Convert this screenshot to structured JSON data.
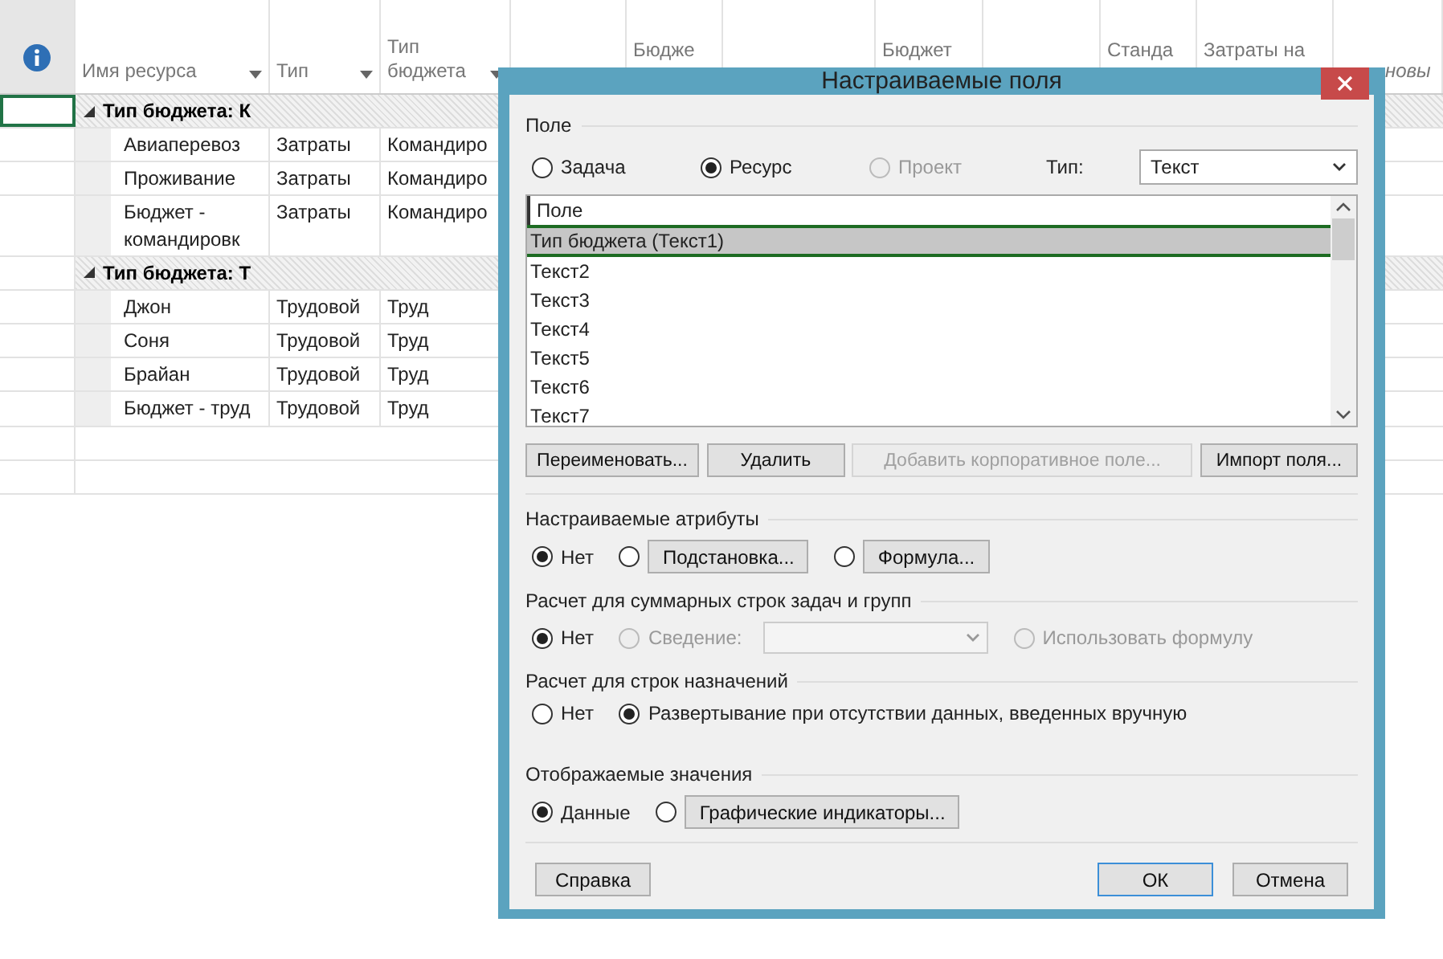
{
  "sheet": {
    "columns": [
      {
        "label": "Имя ресурса",
        "filter": true
      },
      {
        "label": "Тип",
        "filter": true
      },
      {
        "label": "Тип бюджета",
        "filter": true
      },
      {
        "label": "Бюдже",
        "filter": false
      },
      {
        "label": "Бюджет",
        "filter": false
      },
      {
        "label": "Станда",
        "filter": false
      },
      {
        "label": "Затраты на",
        "filter": false
      },
      {
        "label": "новы",
        "filter": false,
        "kind": "add"
      }
    ],
    "groups": [
      {
        "label": "Тип бюджета: К",
        "expanded": true,
        "selected": true,
        "children": [
          {
            "name": "Авиаперевоз",
            "type": "Затраты",
            "budget_type": "Командиро",
            "selected": false
          },
          {
            "name": "Проживание",
            "type": "Затраты",
            "budget_type": "Командиро",
            "selected": false
          },
          {
            "name": "Бюджет - командировк",
            "type": "Затраты",
            "budget_type": "Командиро",
            "selected": false
          }
        ]
      },
      {
        "label": "Тип бюджета: Т",
        "expanded": true,
        "selected": false,
        "children": [
          {
            "name": "Джон",
            "type": "Трудовой",
            "budget_type": "Труд",
            "selected": false
          },
          {
            "name": "Соня",
            "type": "Трудовой",
            "budget_type": "Труд",
            "selected": false
          },
          {
            "name": "Брайан",
            "type": "Трудовой",
            "budget_type": "Труд",
            "selected": false
          },
          {
            "name": "Бюджет - труд",
            "type": "Трудовой",
            "budget_type": "Труд",
            "selected": false
          }
        ]
      }
    ]
  },
  "dialog": {
    "title": "Настраиваемые поля",
    "field": {
      "title": "Поле",
      "scope": [
        {
          "label": "Задача",
          "selected": false,
          "disabled": false
        },
        {
          "label": "Ресурс",
          "selected": true,
          "disabled": false
        },
        {
          "label": "Проект",
          "selected": false,
          "disabled": true
        }
      ],
      "type_label": "Тип:",
      "type_value": "Текст",
      "list_header": "Поле",
      "items": [
        {
          "label": "Тип бюджета (Текст1)",
          "selected": true
        },
        {
          "label": "Текст2",
          "selected": false
        },
        {
          "label": "Текст3",
          "selected": false
        },
        {
          "label": "Текст4",
          "selected": false
        },
        {
          "label": "Текст5",
          "selected": false
        },
        {
          "label": "Текст6",
          "selected": false
        },
        {
          "label": "Текст7",
          "selected": false
        }
      ],
      "buttons": [
        {
          "label": "Переименовать...",
          "disabled": false
        },
        {
          "label": "Удалить",
          "disabled": false
        },
        {
          "label": "Добавить корпоративное поле...",
          "disabled": true
        },
        {
          "label": "Импорт поля...",
          "disabled": false
        }
      ]
    },
    "sections": [
      {
        "title": "Настраиваемые атрибуты",
        "options": [
          {
            "kind": "radio",
            "label": "Нет",
            "selected": true,
            "disabled": false
          },
          {
            "kind": "radio_button",
            "label": "Подстановка...",
            "selected": false,
            "disabled": false
          },
          {
            "kind": "radio_button",
            "label": "Формула...",
            "selected": false,
            "disabled": false
          }
        ]
      },
      {
        "title": "Расчет для суммарных строк задач и групп",
        "options": [
          {
            "kind": "radio",
            "label": "Нет",
            "selected": true,
            "disabled": false
          },
          {
            "kind": "radio_select",
            "label": "Сведение:",
            "selected": false,
            "disabled": true
          },
          {
            "kind": "radio",
            "label": "Использовать формулу",
            "selected": false,
            "disabled": true
          }
        ]
      },
      {
        "title": "Расчет для строк назначений",
        "options": [
          {
            "kind": "radio",
            "label": "Нет",
            "selected": false,
            "disabled": false
          },
          {
            "kind": "radio",
            "label": "Развертывание при отсутствии данных, введенных вручную",
            "selected": true,
            "disabled": false
          }
        ]
      },
      {
        "title": "Отображаемые значения",
        "options": [
          {
            "kind": "radio",
            "label": "Данные",
            "selected": true,
            "disabled": false
          },
          {
            "kind": "radio_button",
            "label": "Графические индикаторы...",
            "selected": false,
            "disabled": false
          }
        ]
      }
    ],
    "footer": {
      "help": "Справка",
      "ok": "ОК",
      "cancel": "Отмена"
    }
  }
}
